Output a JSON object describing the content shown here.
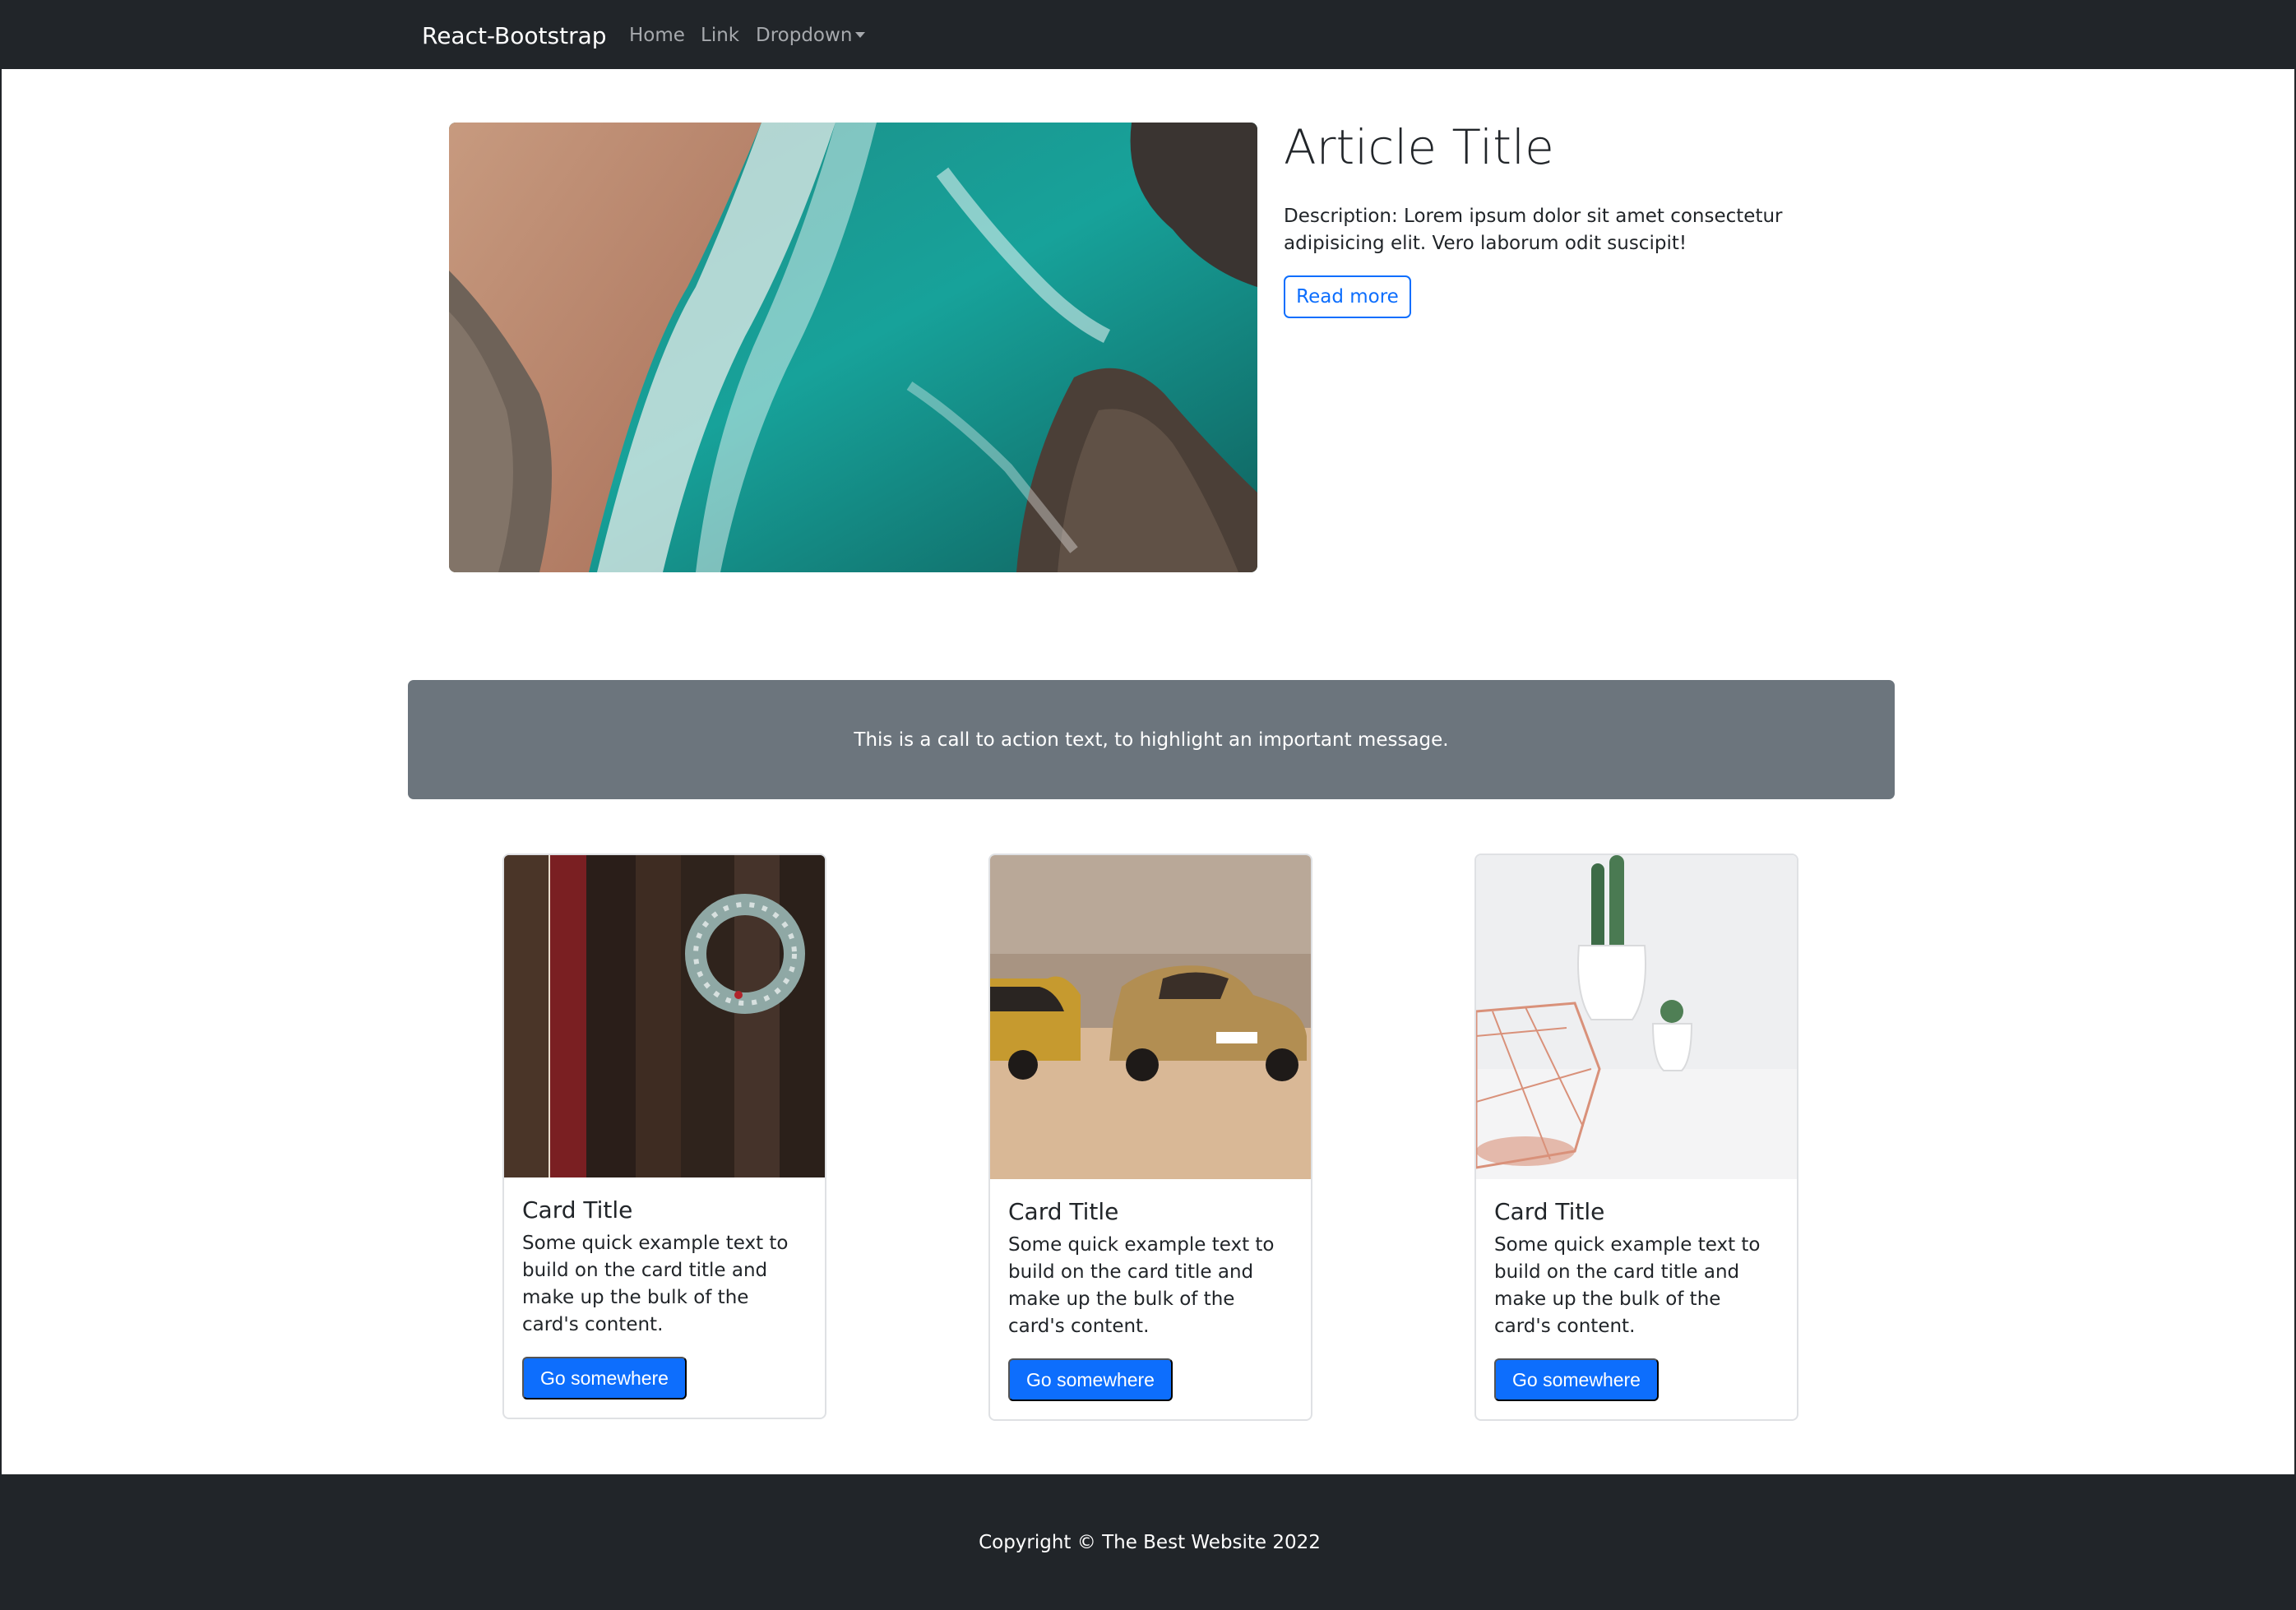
{
  "navbar": {
    "brand": "React-Bootstrap",
    "links": [
      "Home",
      "Link",
      "Dropdown"
    ]
  },
  "hero": {
    "title": "Article Title",
    "description": "Description: Lorem ipsum dolor sit amet consectetur adipisicing elit. Vero laborum odit suscipit!",
    "button_label": "Read more"
  },
  "cta": {
    "text": "This is a call to action text, to highlight an important message."
  },
  "cards": [
    {
      "title": "Card Title",
      "text": "Some quick example text to build on the card title and make up the bulk of the card's content.",
      "button_label": "Go somewhere"
    },
    {
      "title": "Card Title",
      "text": "Some quick example text to build on the card title and make up the bulk of the card's content.",
      "button_label": "Go somewhere"
    },
    {
      "title": "Card Title",
      "text": "Some quick example text to build on the card title and make up the bulk of the card's content.",
      "button_label": "Go somewhere"
    }
  ],
  "footer": {
    "copyright": "Copyright © The Best Website 2022"
  },
  "colors": {
    "navbar_bg": "#212529",
    "primary": "#0d6efd",
    "cta_bg": "#6c757d"
  }
}
